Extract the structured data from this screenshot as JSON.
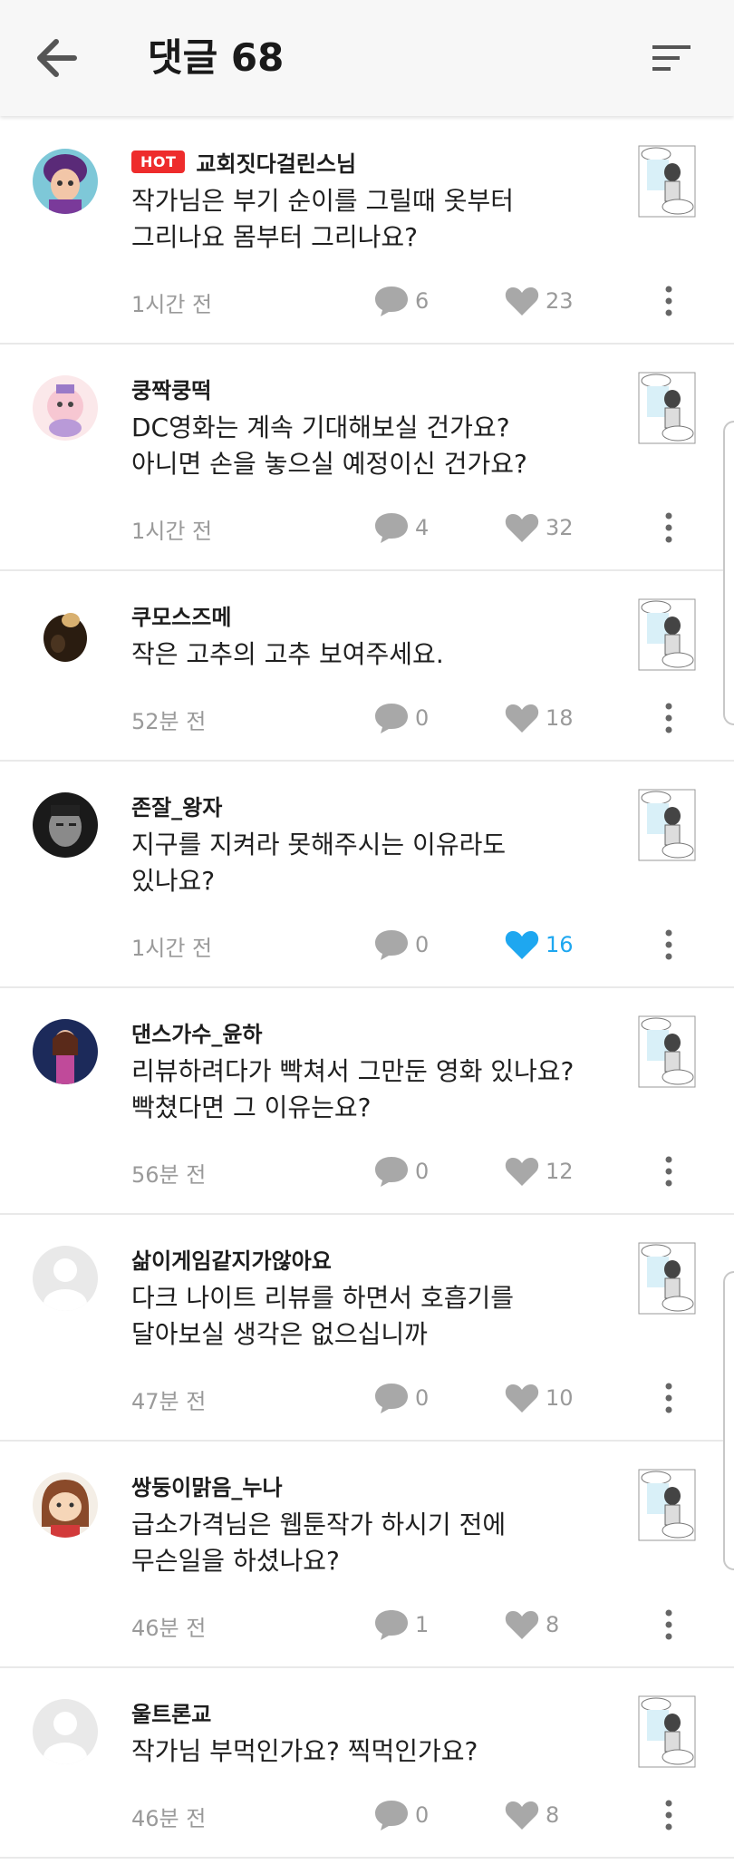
{
  "header": {
    "title": "댓글 68",
    "back_icon": "arrow-left-icon",
    "sort_icon": "sort-icon"
  },
  "colors": {
    "hot": "#ee2c2c",
    "liked": "#1ea7f0",
    "meta_gray": "#9a9a9a",
    "icon_gray": "#a8a8a8"
  },
  "comments": [
    {
      "hot": true,
      "hot_label": "HOT",
      "user": "교회짓다걸린스님",
      "text": "작가님은 부기 순이를 그릴때 옷부터\n그리나요 몸부터 그리나요?",
      "time": "1시간 전",
      "replies": "6",
      "likes": "23",
      "liked": false,
      "avatar": "avatar-game-character"
    },
    {
      "hot": false,
      "user": "쿵짝쿵떡",
      "text": "DC영화는 계속 기대해보실 건가요?\n아니면 손을 놓으실 예정이신 건가요?",
      "time": "1시간 전",
      "replies": "4",
      "likes": "32",
      "liked": false,
      "avatar": "avatar-pink-character"
    },
    {
      "hot": false,
      "user": "쿠모스즈메",
      "text": "작은 고추의 고추 보여주세요.",
      "time": "52분 전",
      "replies": "0",
      "likes": "18",
      "liked": false,
      "avatar": "avatar-dark-figure"
    },
    {
      "hot": false,
      "user": "존잘_왕자",
      "text": "지구를 지켜라 못해주시는 이유라도\n있나요?",
      "time": "1시간 전",
      "replies": "0",
      "likes": "16",
      "liked": true,
      "avatar": "avatar-bw-photo"
    },
    {
      "hot": false,
      "user": "댄스가수_윤하",
      "text": "리뷰하려다가 빡쳐서 그만둔 영화 있나요?\n빡쳤다면 그 이유는요?",
      "time": "56분 전",
      "replies": "0",
      "likes": "12",
      "liked": false,
      "avatar": "avatar-singer-photo"
    },
    {
      "hot": false,
      "user": "삶이게임같지가않아요",
      "text": "다크 나이트 리뷰를 하면서 호흡기를\n달아보실 생각은 없으십니까",
      "time": "47분 전",
      "replies": "0",
      "likes": "10",
      "liked": false,
      "avatar": "avatar-default"
    },
    {
      "hot": false,
      "user": "쌍둥이맑음_누나",
      "text": "급소가격님은 웹툰작가 하시기 전에\n무슨일을 하셨나요?",
      "time": "46분 전",
      "replies": "1",
      "likes": "8",
      "liked": false,
      "avatar": "avatar-cartoon-girl"
    },
    {
      "hot": false,
      "user": "울트론교",
      "text": "작가님 부먹인가요? 찍먹인가요?",
      "time": "46분 전",
      "replies": "0",
      "likes": "8",
      "liked": false,
      "avatar": "avatar-default"
    }
  ]
}
